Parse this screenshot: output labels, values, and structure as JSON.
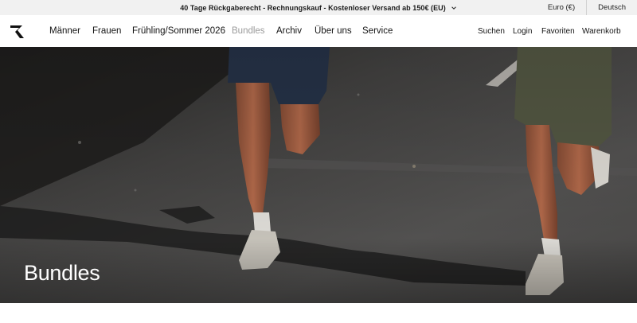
{
  "announcement": {
    "text": "40 Tage Rückgaberecht - Rechnungskauf - Kostenloser Versand ab 150€ (EU)",
    "icon": "chevron-down-icon"
  },
  "locale": {
    "currency": "Euro (€)",
    "language": "Deutsch"
  },
  "nav": {
    "logo_icon": "brand-logo-icon",
    "menu": [
      {
        "label": "Männer"
      },
      {
        "label": "Frauen"
      },
      {
        "label": "Frühling/Sommer 2026"
      },
      {
        "label": "Bundles",
        "active": true
      },
      {
        "label": "Archiv"
      },
      {
        "label": "Über uns"
      },
      {
        "label": "Service"
      }
    ],
    "right": [
      {
        "label": "Suchen"
      },
      {
        "label": "Login"
      },
      {
        "label": "Favoriten"
      },
      {
        "label": "Warenkorb"
      }
    ]
  },
  "hero": {
    "title": "Bundles",
    "image_subject": "two runners on asphalt road"
  },
  "colors": {
    "announcement_bg": "#f1f1f1",
    "active_menu": "#9a9a9a",
    "text": "#141414",
    "hero_title": "#ffffff"
  }
}
